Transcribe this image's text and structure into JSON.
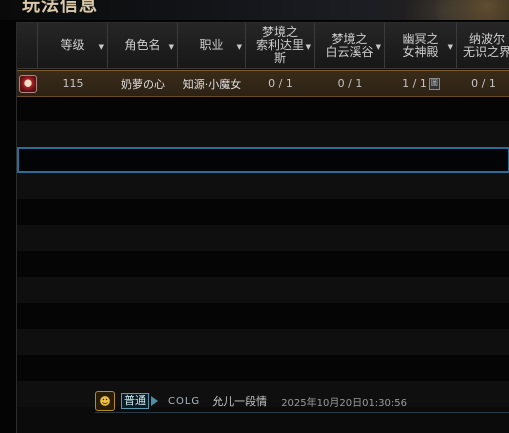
{
  "window": {
    "title": "玩法信息"
  },
  "table": {
    "columns": [
      {
        "label": ""
      },
      {
        "label": "等级",
        "sort": "▼"
      },
      {
        "label": "角色名",
        "sort": "▼"
      },
      {
        "label": "职业",
        "sort": "▼"
      },
      {
        "label": "梦境之\n索利达里\n斯",
        "sort": "▼"
      },
      {
        "label": "梦境之\n白云溪谷",
        "sort": "▼"
      },
      {
        "label": "幽冥之\n女神殿",
        "sort": "▼"
      },
      {
        "label": "纳波尔\n无识之界",
        "sort": "▼"
      }
    ],
    "rows": [
      {
        "level": "115",
        "name": "奶萝の心",
        "class": "知源·小魔女",
        "c1": "0 / 1",
        "c2": "0 / 1",
        "c3": "1 / 1",
        "c3_icon": "圖",
        "c4": "0 / 1"
      }
    ]
  },
  "chat": {
    "emoji_icon": "smiley-icon",
    "channel": "普通",
    "user": "COLG",
    "message": "允儿一段情",
    "time": "2025年10月20日01:30:56"
  }
}
